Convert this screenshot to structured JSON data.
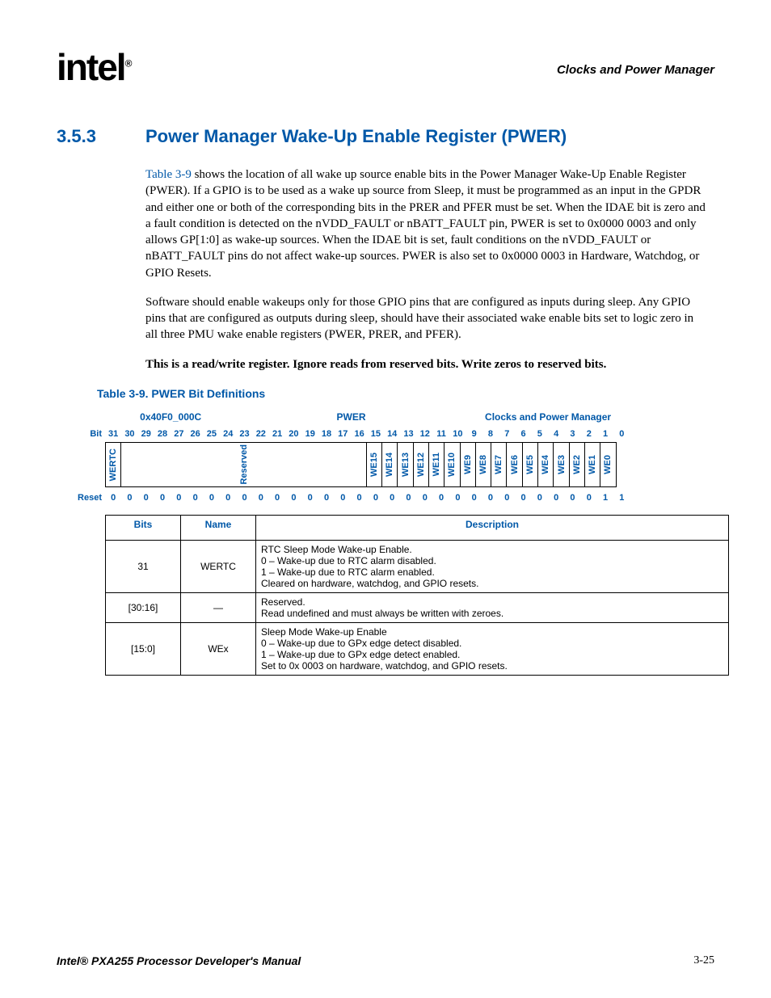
{
  "header": {
    "logo": "intel",
    "right": "Clocks and Power Manager"
  },
  "section": {
    "number": "3.5.3",
    "title": "Power Manager Wake-Up Enable Register (PWER)"
  },
  "paras": {
    "p1_link": "Table 3-9",
    "p1_rest": " shows the location of all wake up source enable bits in the Power Manager Wake-Up Enable Register (PWER). If a GPIO is to be used as a wake up source from Sleep, it must be programmed as an input in the GPDR and either one or both of the corresponding bits in the PRER and PFER must be set. When the IDAE bit is zero and a fault condition is detected on the nVDD_FAULT or nBATT_FAULT pin, PWER is set to 0x0000 0003 and only allows GP[1:0] as wake-up sources. When the IDAE bit is set, fault conditions on the nVDD_FAULT or nBATT_FAULT pins do not affect wake-up sources. PWER is also set to 0x0000 0003 in Hardware, Watchdog, or GPIO Resets.",
    "p2": "Software should enable wakeups only for those GPIO pins that are configured as inputs during sleep. Any GPIO pins that are configured as outputs during sleep, should have their associated wake enable bits set to logic zero in all three PMU wake enable registers (PWER, PRER, and PFER).",
    "p3": "This is a read/write register. Ignore reads from reserved bits. Write zeros to reserved bits."
  },
  "table_caption": "Table 3-9. PWER Bit Definitions",
  "reg": {
    "address": "0x40F0_000C",
    "name": "PWER",
    "group": "Clocks and Power Manager",
    "bit_label": "Bit",
    "reset_label": "Reset",
    "bits": [
      "31",
      "30",
      "29",
      "28",
      "27",
      "26",
      "25",
      "24",
      "23",
      "22",
      "21",
      "20",
      "19",
      "18",
      "17",
      "16",
      "15",
      "14",
      "13",
      "12",
      "11",
      "10",
      "9",
      "8",
      "7",
      "6",
      "5",
      "4",
      "3",
      "2",
      "1",
      "0"
    ],
    "fields": [
      {
        "span": 1,
        "label": "WERTC",
        "vert": true
      },
      {
        "span": 15,
        "label": "Reserved",
        "vert": true
      },
      {
        "span": 1,
        "label": "WE15",
        "vert": true
      },
      {
        "span": 1,
        "label": "WE14",
        "vert": true
      },
      {
        "span": 1,
        "label": "WE13",
        "vert": true
      },
      {
        "span": 1,
        "label": "WE12",
        "vert": true
      },
      {
        "span": 1,
        "label": "WE11",
        "vert": true
      },
      {
        "span": 1,
        "label": "WE10",
        "vert": true
      },
      {
        "span": 1,
        "label": "WE9",
        "vert": true
      },
      {
        "span": 1,
        "label": "WE8",
        "vert": true
      },
      {
        "span": 1,
        "label": "WE7",
        "vert": true
      },
      {
        "span": 1,
        "label": "WE6",
        "vert": true
      },
      {
        "span": 1,
        "label": "WE5",
        "vert": true
      },
      {
        "span": 1,
        "label": "WE4",
        "vert": true
      },
      {
        "span": 1,
        "label": "WE3",
        "vert": true
      },
      {
        "span": 1,
        "label": "WE2",
        "vert": true
      },
      {
        "span": 1,
        "label": "WE1",
        "vert": true
      },
      {
        "span": 1,
        "label": "WE0",
        "vert": true
      }
    ],
    "reset": [
      "0",
      "0",
      "0",
      "0",
      "0",
      "0",
      "0",
      "0",
      "0",
      "0",
      "0",
      "0",
      "0",
      "0",
      "0",
      "0",
      "0",
      "0",
      "0",
      "0",
      "0",
      "0",
      "0",
      "0",
      "0",
      "0",
      "0",
      "0",
      "0",
      "0",
      "1",
      "1"
    ]
  },
  "desc": {
    "hdr_bits": "Bits",
    "hdr_name": "Name",
    "hdr_desc": "Description",
    "rows": [
      {
        "bits": "31",
        "name": "WERTC",
        "desc": "RTC Sleep Mode Wake-up Enable.\n0 –  Wake-up due to RTC alarm disabled.\n1 –  Wake-up due to RTC alarm enabled.\nCleared on hardware, watchdog, and GPIO resets."
      },
      {
        "bits": "[30:16]",
        "name": "—",
        "desc": "Reserved.\nRead undefined and must always be written with zeroes."
      },
      {
        "bits": "[15:0]",
        "name": "WEx",
        "desc": "Sleep Mode Wake-up Enable\n0 –  Wake-up due to GPx edge detect disabled.\n1 –  Wake-up due to GPx edge detect enabled.\nSet to 0x 0003 on hardware, watchdog, and GPIO resets."
      }
    ]
  },
  "footer": {
    "left": "Intel® PXA255 Processor Developer's Manual",
    "right": "3-25"
  }
}
